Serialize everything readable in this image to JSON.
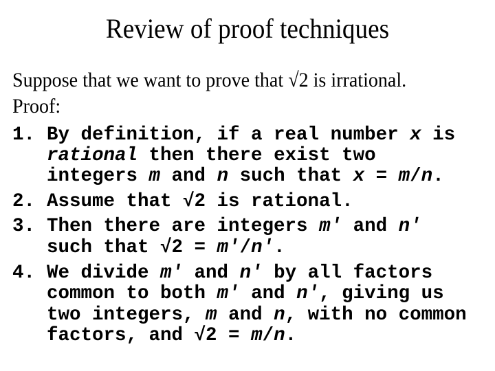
{
  "slide": {
    "title": "Review of proof techniques",
    "intro": [
      "Suppose that we want to prove that √2 is irrational.",
      "Proof:"
    ],
    "steps": [
      {
        "number": "1.",
        "lines": [
          [
            {
              "t": "By definition, if a real number "
            },
            {
              "t": "x",
              "i": true
            },
            {
              "t": " is"
            }
          ],
          [
            {
              "t": "rational",
              "i": true
            },
            {
              "t": " then there exist two"
            }
          ],
          [
            {
              "t": "integers "
            },
            {
              "t": "m",
              "i": true
            },
            {
              "t": " and "
            },
            {
              "t": "n",
              "i": true
            },
            {
              "t": " such that "
            },
            {
              "t": "x",
              "i": true
            },
            {
              "t": " = "
            },
            {
              "t": "m",
              "i": true
            },
            {
              "t": "/"
            },
            {
              "t": "n",
              "i": true
            },
            {
              "t": "."
            }
          ]
        ]
      },
      {
        "number": "2.",
        "lines": [
          [
            {
              "t": "Assume that √2 is rational."
            }
          ]
        ]
      },
      {
        "number": "3.",
        "lines": [
          [
            {
              "t": "Then there are integers "
            },
            {
              "t": "m′",
              "i": true
            },
            {
              "t": " and "
            },
            {
              "t": "n′",
              "i": true
            }
          ],
          [
            {
              "t": "such that √2 = "
            },
            {
              "t": "m′",
              "i": true
            },
            {
              "t": "/"
            },
            {
              "t": "n′",
              "i": true
            },
            {
              "t": "."
            }
          ]
        ]
      },
      {
        "number": "4.",
        "lines": [
          [
            {
              "t": "We divide "
            },
            {
              "t": "m′",
              "i": true
            },
            {
              "t": " and "
            },
            {
              "t": "n′",
              "i": true
            },
            {
              "t": " by all factors"
            }
          ],
          [
            {
              "t": "common to both "
            },
            {
              "t": "m′",
              "i": true
            },
            {
              "t": " and "
            },
            {
              "t": "n′",
              "i": true
            },
            {
              "t": ", giving us"
            }
          ],
          [
            {
              "t": "two integers, "
            },
            {
              "t": "m",
              "i": true
            },
            {
              "t": " and "
            },
            {
              "t": "n",
              "i": true
            },
            {
              "t": ", with no common"
            }
          ],
          [
            {
              "t": "factors, and √2 = "
            },
            {
              "t": "m",
              "i": true
            },
            {
              "t": "/"
            },
            {
              "t": "n",
              "i": true
            },
            {
              "t": "."
            }
          ]
        ]
      }
    ]
  }
}
